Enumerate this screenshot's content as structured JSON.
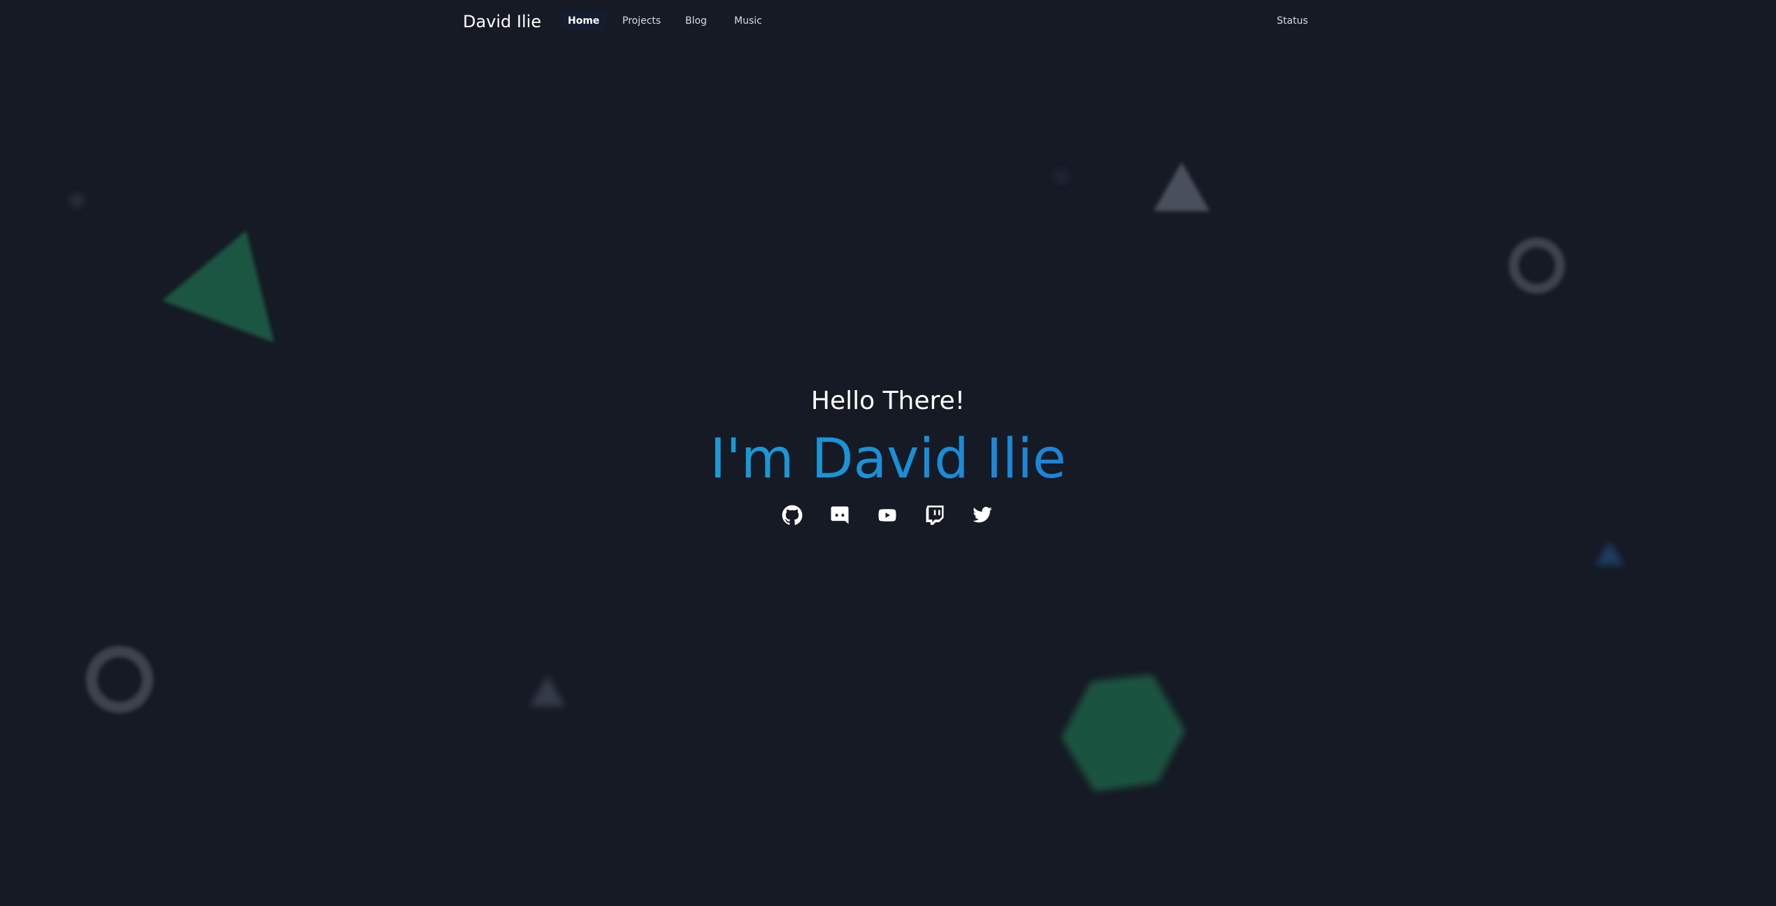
{
  "brand": "David Ilie",
  "nav": {
    "items": [
      {
        "label": "Home",
        "active": true
      },
      {
        "label": "Projects",
        "active": false
      },
      {
        "label": "Blog",
        "active": false
      },
      {
        "label": "Music",
        "active": false
      }
    ],
    "status_label": "Status"
  },
  "hero": {
    "greeting": "Hello There!",
    "name": "I'm David Ilie"
  },
  "socials": [
    {
      "icon": "github-icon"
    },
    {
      "icon": "discord-icon"
    },
    {
      "icon": "youtube-icon"
    },
    {
      "icon": "twitch-icon"
    },
    {
      "icon": "twitter-icon"
    }
  ],
  "colors": {
    "background": "#161a24",
    "accent_gradient_start": "#1a9bd6",
    "accent_gradient_end": "#1b84d9",
    "shape_green": "#1d5a45",
    "shape_gray": "#4a4f5c"
  }
}
